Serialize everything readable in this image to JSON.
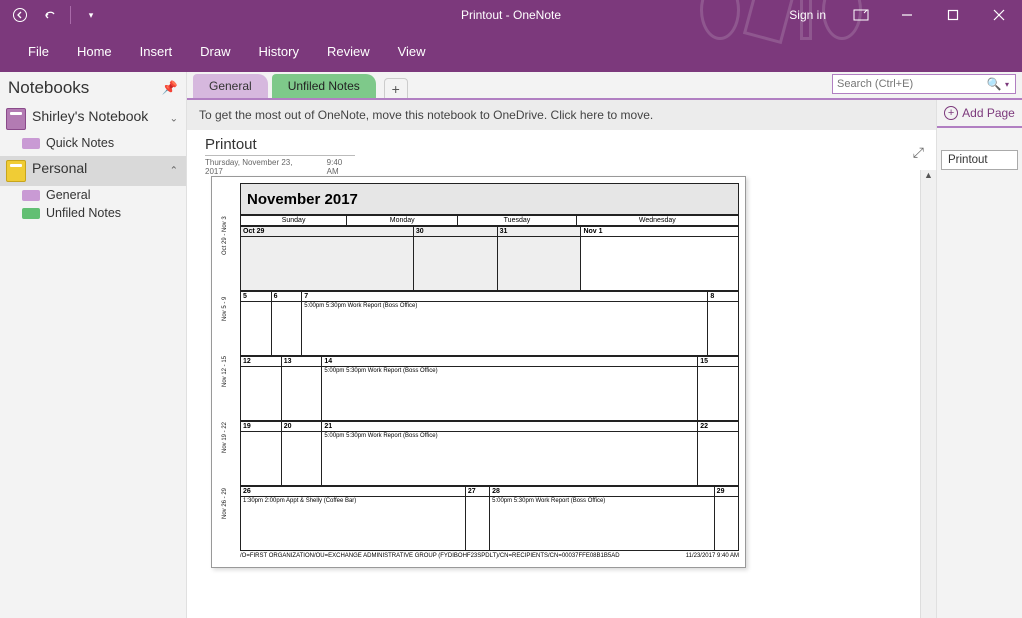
{
  "window": {
    "title": "Printout  -  OneNote",
    "signin": "Sign in"
  },
  "menu": [
    "File",
    "Home",
    "Insert",
    "Draw",
    "History",
    "Review",
    "View"
  ],
  "sidebar": {
    "heading": "Notebooks",
    "notebooks": [
      {
        "name": "Shirley's Notebook",
        "sections": [
          {
            "label": "Quick Notes",
            "color": "purple"
          }
        ]
      },
      {
        "name": "Personal",
        "sections": [
          {
            "label": "General",
            "color": "purple"
          },
          {
            "label": "Unfiled Notes",
            "color": "green"
          }
        ]
      }
    ]
  },
  "tabs": [
    {
      "label": "General",
      "kind": "active"
    },
    {
      "label": "Unfiled Notes",
      "kind": "green"
    }
  ],
  "search": {
    "placeholder": "Search (Ctrl+E)"
  },
  "onedrive_msg": "To get the most out of OneNote, move this notebook to OneDrive. Click here to move.",
  "page": {
    "title": "Printout",
    "date": "Thursday, November 23, 2017",
    "time": "9:40 AM"
  },
  "addpage_label": "Add Page",
  "page_list": [
    "Printout"
  ],
  "calendar": {
    "title": "November 2017",
    "day_headers": [
      "Sunday",
      "Monday",
      "Tuesday",
      "Wednesday"
    ],
    "week_labels": [
      "Oct 29 - Nov 3",
      "Nov 5 - 9",
      "Nov 12 - 15",
      "Nov 19 - 22",
      "Nov 26 - 29"
    ],
    "weeks": [
      {
        "dates": [
          "Oct 29",
          "30",
          "31",
          "Nov 1"
        ],
        "dim": [
          true,
          true,
          true,
          false
        ],
        "events": [
          "",
          "",
          "",
          ""
        ]
      },
      {
        "dates": [
          "5",
          "6",
          "7",
          "8"
        ],
        "dim": [
          false,
          false,
          false,
          false
        ],
        "events": [
          "",
          "",
          "5:00pm 5:30pm Work Report  (Boss Office)",
          ""
        ]
      },
      {
        "dates": [
          "12",
          "13",
          "14",
          "15"
        ],
        "dim": [
          false,
          false,
          false,
          false
        ],
        "events": [
          "",
          "",
          "5:00pm 5:30pm Work Report  (Boss Office)",
          ""
        ]
      },
      {
        "dates": [
          "19",
          "20",
          "21",
          "22"
        ],
        "dim": [
          false,
          false,
          false,
          false
        ],
        "events": [
          "",
          "",
          "5:00pm 5:30pm Work Report  (Boss Office)",
          ""
        ]
      },
      {
        "dates": [
          "26",
          "27",
          "28",
          "29"
        ],
        "dim": [
          false,
          false,
          false,
          false
        ],
        "events": [
          "1:30pm 2:00pm Appt & Shelly (Coffee Bar)",
          "",
          "5:00pm 5:30pm Work Report  (Boss Office)",
          ""
        ]
      }
    ],
    "footer_left": "/O=FIRST ORGANIZATION/OU=EXCHANGE ADMINISTRATIVE GROUP (FYDIBOHF23SPDLT)/CN=RECIPIENTS/CN=00037FFE08B1B5AD",
    "footer_right": "11/23/2017 9:40 AM"
  }
}
